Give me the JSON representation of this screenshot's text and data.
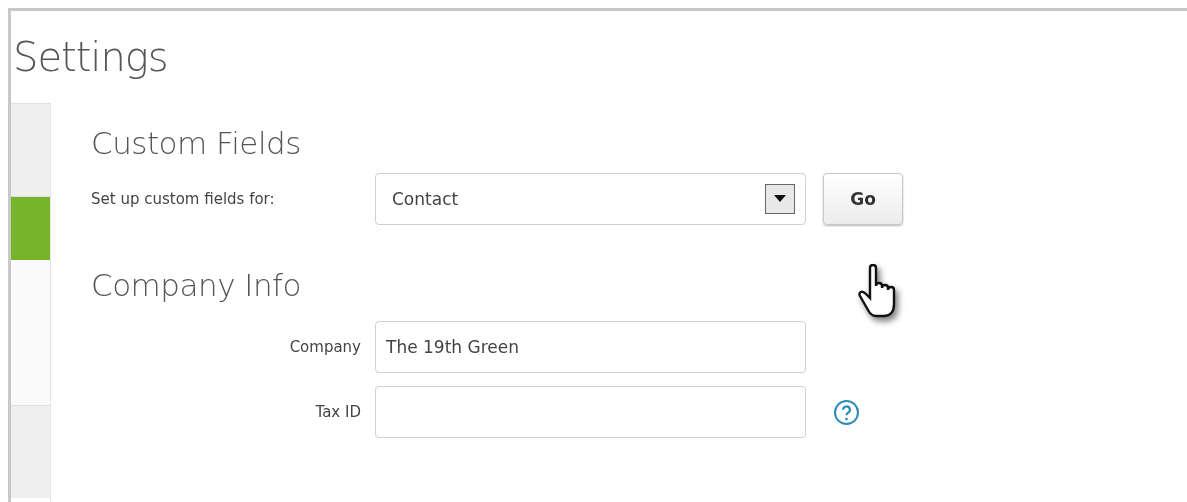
{
  "page": {
    "title": "Settings"
  },
  "sidebar": {
    "tabs": [
      {
        "kind": "tab",
        "selected": false
      },
      {
        "kind": "tab",
        "selected": true
      },
      {
        "kind": "blank"
      },
      {
        "kind": "tab",
        "selected": false
      }
    ]
  },
  "custom_fields": {
    "heading": "Custom Fields",
    "label": "Set up custom fields for:",
    "select_value": "Contact",
    "button": "Go"
  },
  "company_info": {
    "heading": "Company Info",
    "fields": [
      {
        "label": "Company",
        "value": "The 19th Green"
      },
      {
        "label": "Tax ID",
        "help": true
      }
    ]
  }
}
